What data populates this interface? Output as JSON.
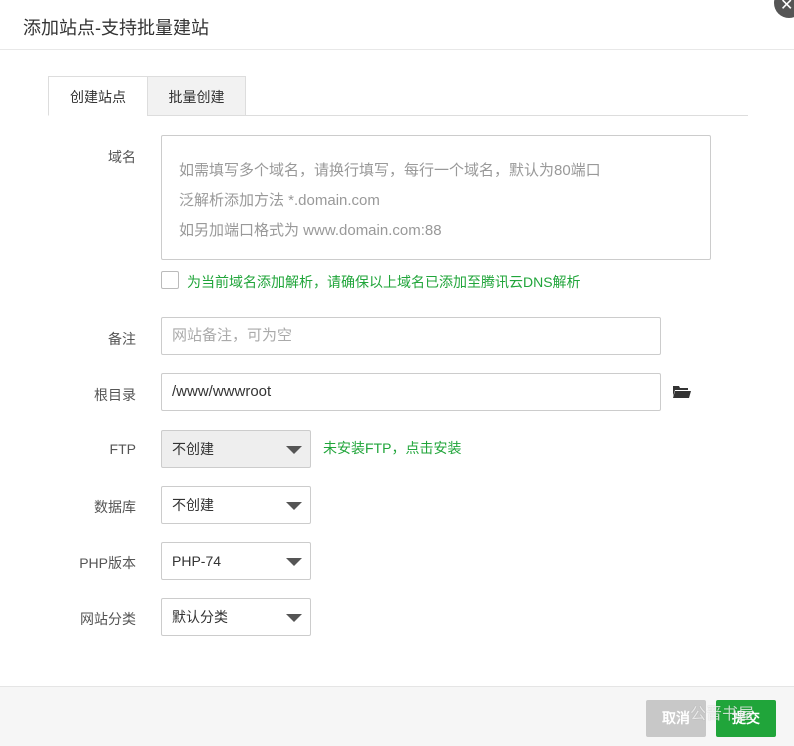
{
  "dialog": {
    "title": "添加站点-支持批量建站"
  },
  "tabs": [
    {
      "label": "创建站点",
      "active": true
    },
    {
      "label": "批量创建",
      "active": false
    }
  ],
  "form": {
    "domain": {
      "label": "域名",
      "placeholder_lines": [
        "如需填写多个域名，请换行填写，每行一个域名，默认为80端口",
        "泛解析添加方法 *.domain.com",
        "如另加端口格式为 www.domain.com:88"
      ],
      "dns_checkbox_label": "为当前域名添加解析，请确保以上域名已添加至腾讯云DNS解析",
      "dns_checked": false
    },
    "remark": {
      "label": "备注",
      "placeholder": "网站备注，可为空"
    },
    "root_dir": {
      "label": "根目录",
      "value": "/www/wwwroot"
    },
    "ftp": {
      "label": "FTP",
      "selected": "不创建",
      "hint": "未安装FTP，点击安装"
    },
    "database": {
      "label": "数据库",
      "selected": "不创建"
    },
    "php_version": {
      "label": "PHP版本",
      "selected": "PHP-74"
    },
    "site_category": {
      "label": "网站分类",
      "selected": "默认分类"
    }
  },
  "footer": {
    "cancel_label": "取消",
    "submit_label": "提交",
    "watermark": "公晋书屋"
  },
  "colors": {
    "accent_green": "#20a53a",
    "cancel_gray": "#c8c8c8"
  }
}
